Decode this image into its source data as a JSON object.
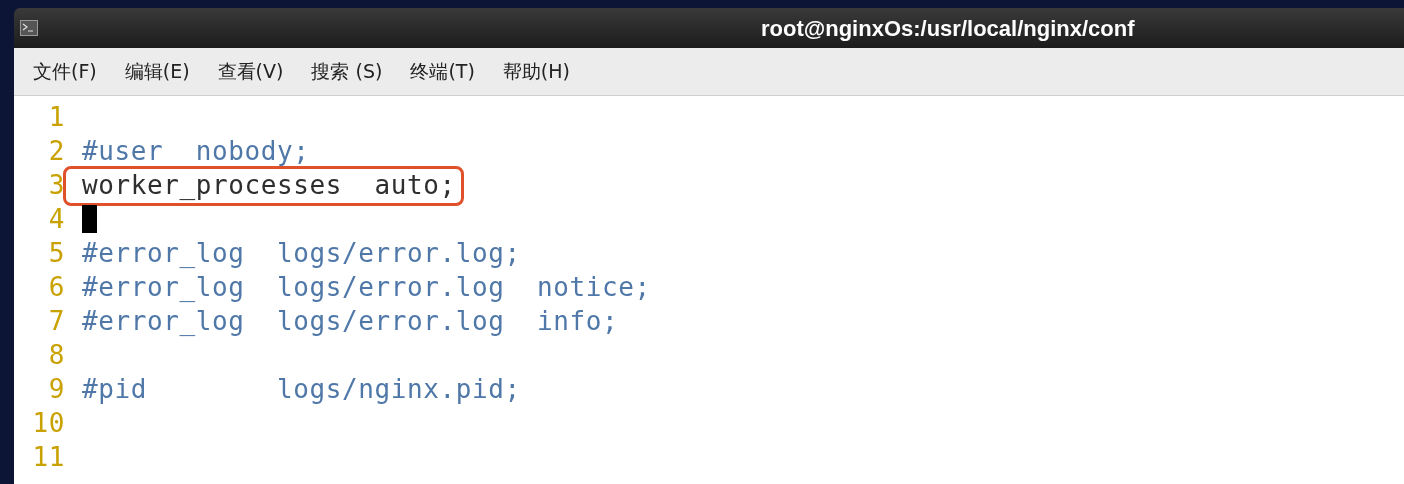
{
  "window": {
    "title": "root@nginxOs:/usr/local/nginx/conf"
  },
  "menu": [
    {
      "label": "文件(F)"
    },
    {
      "label": "编辑(E)"
    },
    {
      "label": "查看(V)"
    },
    {
      "label": "搜索 (S)"
    },
    {
      "label": "终端(T)"
    },
    {
      "label": "帮助(H)"
    }
  ],
  "editor": {
    "lines": [
      {
        "number": "1",
        "cursor": false,
        "highlighted": false
      },
      {
        "number": "2",
        "kind": "comment",
        "text": "#user  nobody;",
        "cursor": false,
        "highlighted": false
      },
      {
        "number": "3",
        "kind": "code",
        "text": "worker_processes  auto;",
        "cursor": false,
        "highlighted": true
      },
      {
        "number": "4",
        "cursor": true,
        "highlighted": false
      },
      {
        "number": "5",
        "kind": "comment",
        "text": "#error_log  logs/error.log;",
        "cursor": false,
        "highlighted": false
      },
      {
        "number": "6",
        "kind": "comment",
        "text": "#error_log  logs/error.log  notice;",
        "cursor": false,
        "highlighted": false
      },
      {
        "number": "7",
        "kind": "comment",
        "text": "#error_log  logs/error.log  info;",
        "cursor": false,
        "highlighted": false
      },
      {
        "number": "8",
        "cursor": false,
        "highlighted": false
      },
      {
        "number": "9",
        "kind": "comment",
        "text": "#pid        logs/nginx.pid;",
        "cursor": false,
        "highlighted": false
      },
      {
        "number": "10",
        "cursor": false,
        "highlighted": false
      },
      {
        "number": "11",
        "cursor": false,
        "highlighted": false
      }
    ]
  }
}
